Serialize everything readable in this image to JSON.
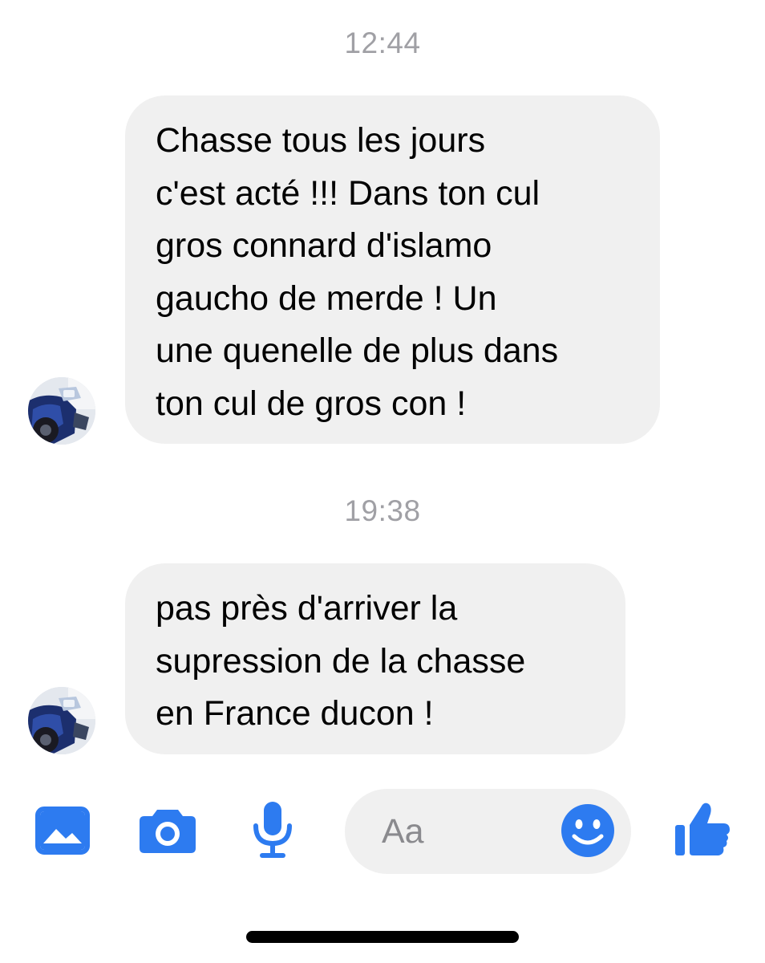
{
  "colors": {
    "accent": "#2d7bf0",
    "bubble_background": "#f0f0f0",
    "timestamp_text": "#a0a0a5"
  },
  "messages": [
    {
      "timestamp": "12:44",
      "lines": [
        "Chasse tous les jours",
        "c'est acté !!! Dans ton cul",
        "gros connard d'islamo",
        "gaucho de merde ! Un",
        "une quenelle de plus dans",
        "ton cul de gros con !"
      ]
    },
    {
      "timestamp": "19:38",
      "lines": [
        "pas près d'arriver la",
        "supression de la chasse",
        "en France ducon !"
      ]
    }
  ],
  "composer": {
    "placeholder": "Aa",
    "icons": [
      "gallery-icon",
      "camera-icon",
      "microphone-icon",
      "emoji-icon",
      "thumbs-up-icon"
    ]
  }
}
